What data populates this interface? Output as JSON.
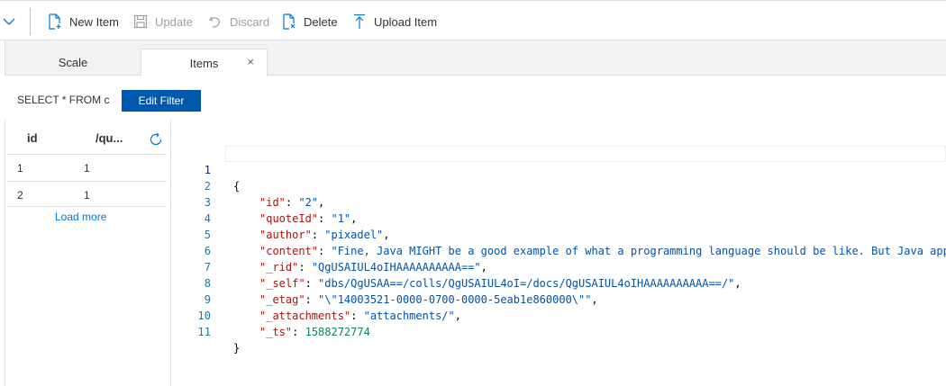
{
  "toolbar": {
    "new_item": "New Item",
    "update": "Update",
    "discard": "Discard",
    "delete": "Delete",
    "upload_item": "Upload Item"
  },
  "tabs": [
    {
      "label": "Scale"
    },
    {
      "label": "Items",
      "close": "×"
    }
  ],
  "filter": {
    "query": "SELECT * FROM c",
    "button": "Edit Filter"
  },
  "table": {
    "headers": [
      "id",
      "/qu..."
    ],
    "rows": [
      {
        "id": "1",
        "quoteId": "1"
      },
      {
        "id": "2",
        "quoteId": "1"
      }
    ],
    "load_more": "Load more"
  },
  "editor": {
    "line_numbers": [
      "1",
      "2",
      "3",
      "4",
      "5",
      "6",
      "7",
      "8",
      "9",
      "10",
      "11"
    ],
    "open_brace": "{",
    "close_brace": "}",
    "fields": [
      {
        "key": "\"id\"",
        "value": "\"2\"",
        "type": "string",
        "comma": ","
      },
      {
        "key": "\"quoteId\"",
        "value": "\"1\"",
        "type": "string",
        "comma": ","
      },
      {
        "key": "\"author\"",
        "value": "\"pixadel\"",
        "type": "string",
        "comma": ","
      },
      {
        "key": "\"content\"",
        "value": "\"Fine, Java MIGHT be a good example of what a programming language should be like. But Java app",
        "type": "string",
        "comma": ""
      },
      {
        "key": "\"_rid\"",
        "value": "\"QgUSAIUL4oIHAAAAAAAAAA==\"",
        "type": "string",
        "comma": ","
      },
      {
        "key": "\"_self\"",
        "value": "\"dbs/QgUSAA==/colls/QgUSAIUL4oI=/docs/QgUSAIUL4oIHAAAAAAAAAA==/\"",
        "type": "string",
        "comma": ","
      },
      {
        "key": "\"_etag\"",
        "value": "\"\\\"14003521-0000-0700-0000-5eab1e860000\\\"\"",
        "type": "string",
        "comma": ","
      },
      {
        "key": "\"_attachments\"",
        "value": "\"attachments/\"",
        "type": "string",
        "comma": ","
      },
      {
        "key": "\"_ts\"",
        "value": "1588272774",
        "type": "number",
        "comma": ""
      }
    ]
  }
}
